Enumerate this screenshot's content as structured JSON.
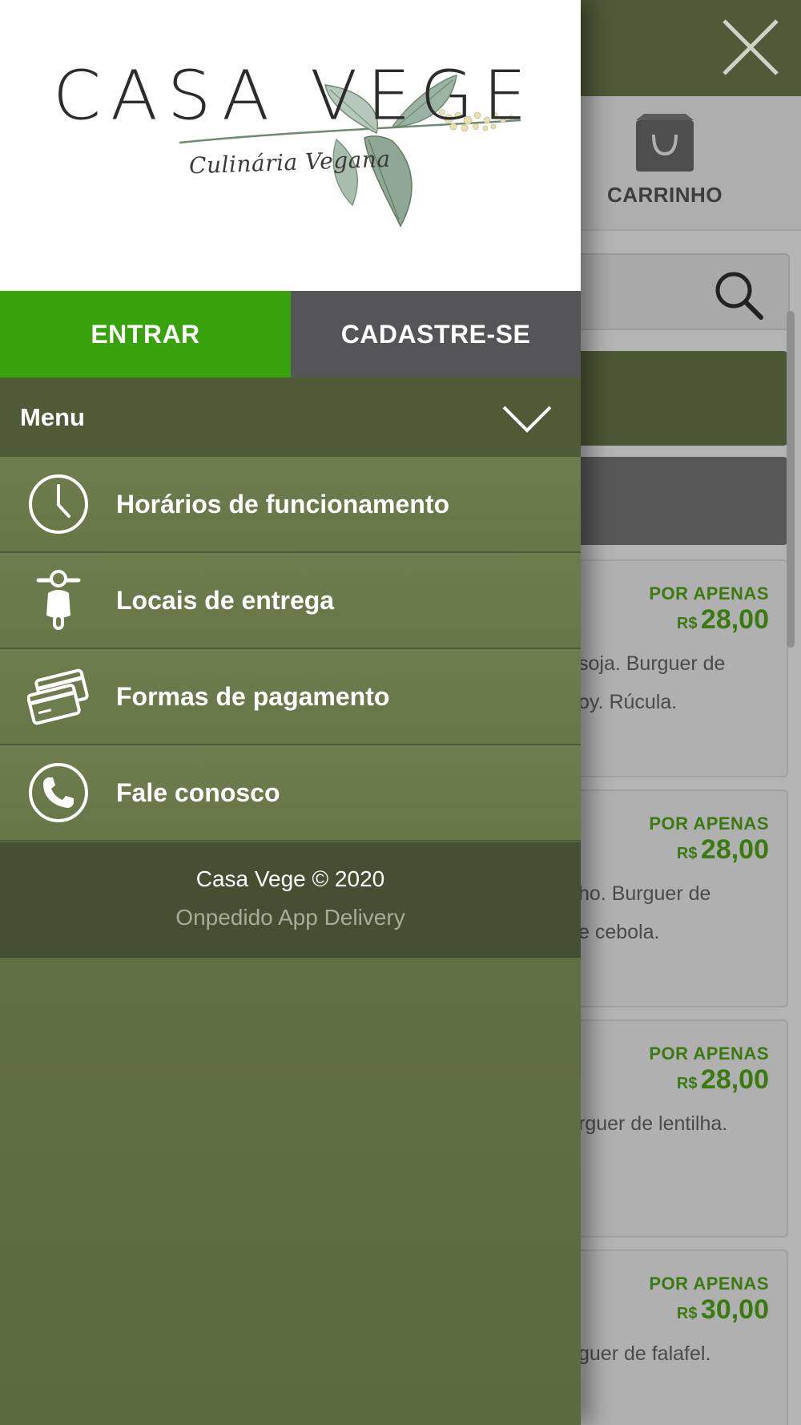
{
  "background": {
    "cart_label": "CARRINHO",
    "products": [
      {
        "promo": "POR APENAS",
        "currency": "R$",
        "price": "28,00",
        "desc_line1": "soja. Burguer de",
        "desc_line2": "oy. Rúcula."
      },
      {
        "promo": "POR APENAS",
        "currency": "R$",
        "price": "28,00",
        "desc_line1": "ho. Burguer de",
        "desc_line2": "e cebola."
      },
      {
        "promo": "POR APENAS",
        "currency": "R$",
        "price": "28,00",
        "desc_line1": "rguer de lentilha.",
        "desc_line2": ""
      },
      {
        "promo": "POR APENAS",
        "currency": "R$",
        "price": "30,00",
        "desc_line1": "guer de falafel.",
        "desc_line2": ""
      }
    ]
  },
  "drawer": {
    "logo": {
      "title": "CASA VEGE",
      "subtitle": "Culinária Vegana"
    },
    "auth": {
      "login_label": "ENTRAR",
      "signup_label": "CADASTRE-SE"
    },
    "menu": {
      "title": "Menu",
      "items": [
        {
          "label": "Horários de funcionamento",
          "icon": "clock-icon"
        },
        {
          "label": "Locais de entrega",
          "icon": "scooter-icon"
        },
        {
          "label": "Formas de pagamento",
          "icon": "credit-cards-icon"
        },
        {
          "label": "Fale conosco",
          "icon": "phone-icon"
        }
      ]
    },
    "footer": {
      "copyright": "Casa Vege © 2020",
      "app_name": "Onpedido App Delivery"
    }
  },
  "colors": {
    "login_green": "#38a20b",
    "signup_gray": "#555557",
    "menu_green": "#6e7d4d",
    "menu_header": "#4f5a36",
    "footer_bg": "#454f31",
    "price_green": "#3b7a10"
  }
}
